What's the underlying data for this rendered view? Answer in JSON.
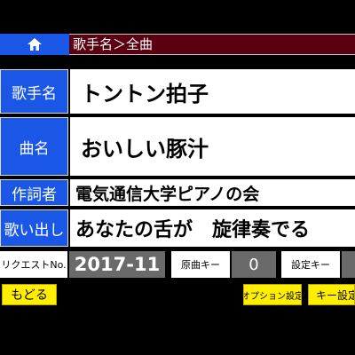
{
  "breadcrumb": {
    "text": "歌手名＞全曲"
  },
  "fields": {
    "artist": {
      "label": "歌手名",
      "value": "トントン拍子"
    },
    "song": {
      "label": "曲名",
      "value": "おいしい豚汁"
    },
    "lyricist": {
      "label": "作詞者",
      "value": "電気通信大学ピアノの会"
    },
    "opening": {
      "label": "歌い出し",
      "value": "あなたの舌が　旋律奏でる"
    }
  },
  "info": {
    "request_label": "リクエストNo.",
    "request_no": "2017-11",
    "original_key_label": "原曲キー",
    "original_key_value": "0",
    "set_key_label": "設定キー",
    "set_key_value": ""
  },
  "buttons": {
    "back": "もどる",
    "options": "オプション設定",
    "key_setting": "キー設定"
  },
  "colors": {
    "accent_blue": "#1a57e6",
    "bar_maroon": "#5a0010",
    "button_yellow": "#ffee00"
  }
}
